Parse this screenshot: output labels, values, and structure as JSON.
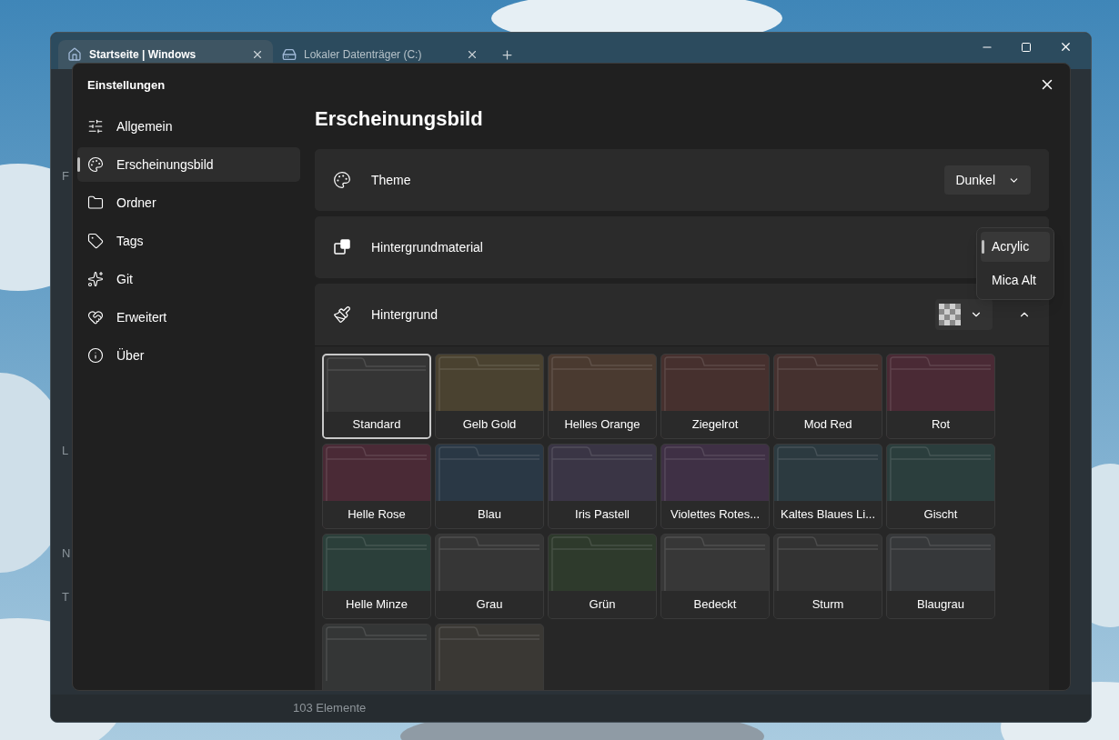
{
  "browser_tabs": [
    {
      "label": "Startseite | Windows",
      "selected": true
    },
    {
      "label": "Lokaler Datenträger (C:)",
      "selected": false
    }
  ],
  "left_fragments": [
    "F",
    "L",
    "N",
    "T"
  ],
  "status_bar": "103 Elemente",
  "settings": {
    "title": "Einstellungen",
    "nav": [
      {
        "label": "Allgemein",
        "selected": false
      },
      {
        "label": "Erscheinungsbild",
        "selected": true
      },
      {
        "label": "Ordner",
        "selected": false
      },
      {
        "label": "Tags",
        "selected": false
      },
      {
        "label": "Git",
        "selected": false
      },
      {
        "label": "Erweitert",
        "selected": false
      },
      {
        "label": "Über",
        "selected": false
      }
    ],
    "heading": "Erscheinungsbild",
    "rows": [
      {
        "kind": "dropdown",
        "label": "Theme",
        "value": "Dunkel"
      },
      {
        "kind": "menu",
        "label": "Hintergrundmaterial"
      },
      {
        "kind": "swatch",
        "label": "Hintergrund",
        "expanded": true
      }
    ],
    "material_menu": [
      {
        "label": "Acrylic",
        "selected": true
      },
      {
        "label": "Mica Alt",
        "selected": false
      }
    ],
    "folder_colors": [
      {
        "label": "Standard",
        "color": "#353535",
        "selected": true
      },
      {
        "label": "Gelb Gold",
        "color": "#4a4230",
        "selected": false
      },
      {
        "label": "Helles Orange",
        "color": "#4a3a30",
        "selected": false
      },
      {
        "label": "Ziegelrot",
        "color": "#46302e",
        "selected": false
      },
      {
        "label": "Mod Red",
        "color": "#45312f",
        "selected": false
      },
      {
        "label": "Rot",
        "color": "#4a2a35",
        "selected": false
      },
      {
        "label": "Helle Rose",
        "color": "#4a2a36",
        "selected": false
      },
      {
        "label": "Blau",
        "color": "#2a3845",
        "selected": false
      },
      {
        "label": "Iris Pastell",
        "color": "#3a3545",
        "selected": false
      },
      {
        "label": "Violettes Rotes...",
        "color": "#3f3045",
        "selected": false
      },
      {
        "label": "Kaltes Blaues Li...",
        "color": "#2c3a40",
        "selected": false
      },
      {
        "label": "Gischt",
        "color": "#2b3e3d",
        "selected": false
      },
      {
        "label": "Helle Minze",
        "color": "#2b3f3a",
        "selected": false
      },
      {
        "label": "Grau",
        "color": "#363636",
        "selected": false
      },
      {
        "label": "Grün",
        "color": "#2e3a2c",
        "selected": false
      },
      {
        "label": "Bedeckt",
        "color": "#373737",
        "selected": false
      },
      {
        "label": "Sturm",
        "color": "#333333",
        "selected": false
      },
      {
        "label": "Blaugrau",
        "color": "#36383a",
        "selected": false
      },
      {
        "color": "#343636",
        "selected": false
      },
      {
        "color": "#3a3834",
        "selected": false
      }
    ]
  }
}
